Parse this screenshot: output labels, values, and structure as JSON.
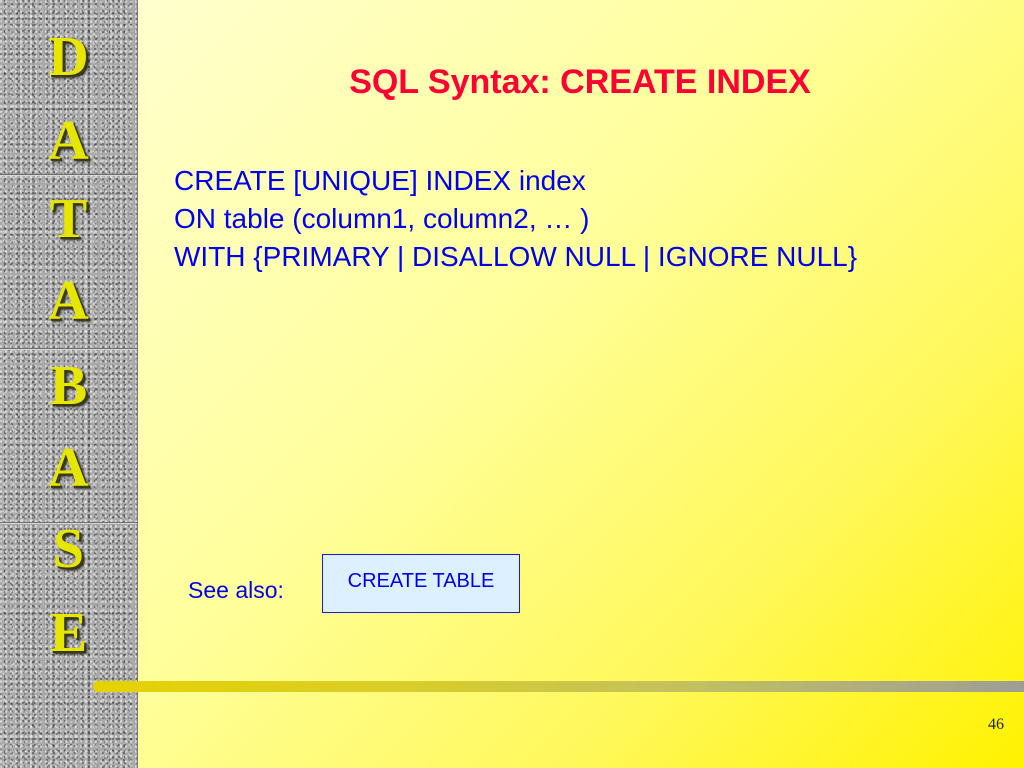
{
  "sidebar": {
    "letters": [
      "D",
      "A",
      "T",
      "A",
      "B",
      "A",
      "S",
      "E"
    ]
  },
  "slide": {
    "title": "SQL Syntax: CREATE INDEX",
    "body_lines": [
      "CREATE [UNIQUE] INDEX index",
      "ON table (column1, column2, … )",
      "WITH {PRIMARY | DISALLOW NULL | IGNORE NULL}"
    ],
    "see_also_label": "See also:",
    "see_also_link": "CREATE TABLE",
    "page_number": "46"
  },
  "colors": {
    "title": "#ff0033",
    "body_text": "#0000ee",
    "sidebar_letters": "#e6e600",
    "link_background": "#dcf0ff"
  }
}
